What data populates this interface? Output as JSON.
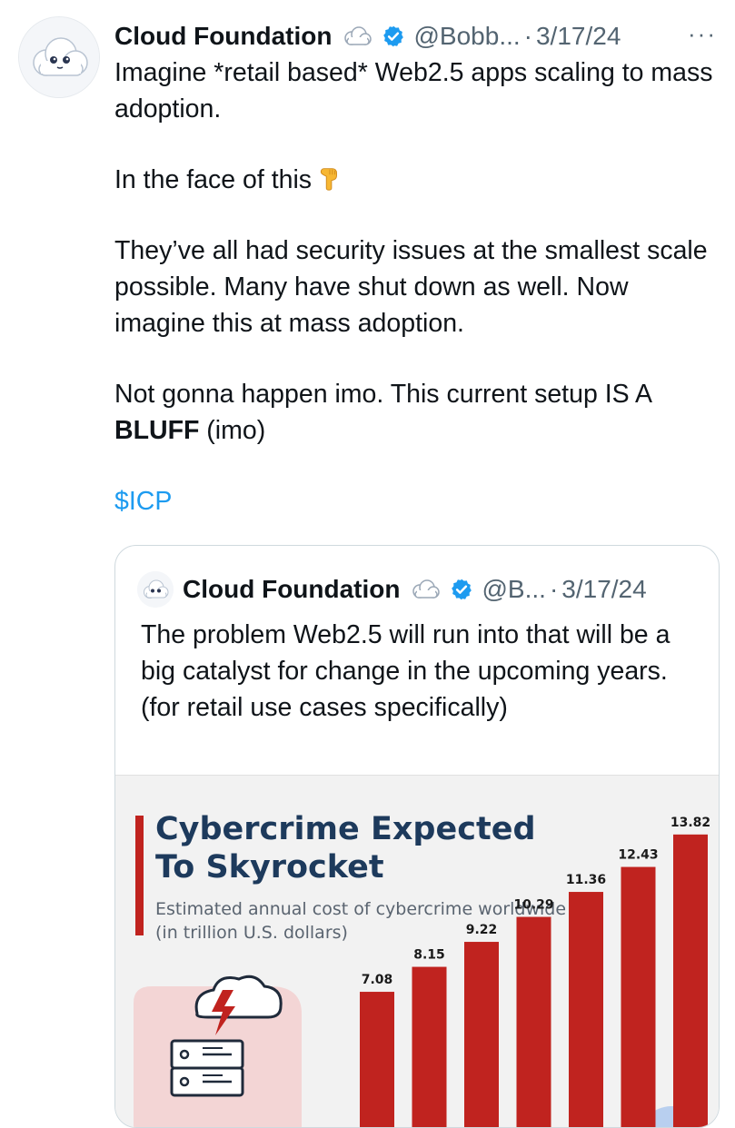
{
  "tweet": {
    "author_name": "Cloud Foundation",
    "handle": "@Bobb...",
    "separator": "·",
    "date": "3/17/24",
    "more": "···",
    "line1": "Imagine *retail based* Web2.5 apps scaling to mass adoption.",
    "line2": "In the face of this",
    "line3": "They’ve all had security issues at the smallest scale possible. Many have shut down as well. Now imagine this at mass adoption.",
    "line4_a": "Not gonna happen imo. This current setup IS A ",
    "line4_bold": "BLUFF",
    "line4_b": " (imo)",
    "cashtag": "$ICP"
  },
  "quote": {
    "author_name": "Cloud Foundation",
    "handle": "@B...",
    "separator": "·",
    "date": "3/17/24",
    "line1": "The problem Web2.5 will run into that will be a big catalyst for change in the upcoming years.",
    "line2": "(for retail use cases specifically)"
  },
  "chart_data": {
    "type": "bar",
    "title": "Cybercrime Expected To Skyrocket",
    "subtitle": "Estimated annual cost of cybercrime worldwide (in trillion U.S. dollars)",
    "title_line1": "Cybercrime Expected",
    "title_line2": "To Skyrocket",
    "subtitle_line1": "Estimated annual cost of cybercrime worldwide",
    "subtitle_line2": "(in trillion U.S. dollars)",
    "values": [
      7.08,
      8.15,
      9.22,
      10.29,
      11.36,
      12.43,
      13.82
    ],
    "bar_color": "#c0231f"
  },
  "colors": {
    "link": "#1d9bf0",
    "verified": "#1d9bf0",
    "muted": "#536471"
  }
}
